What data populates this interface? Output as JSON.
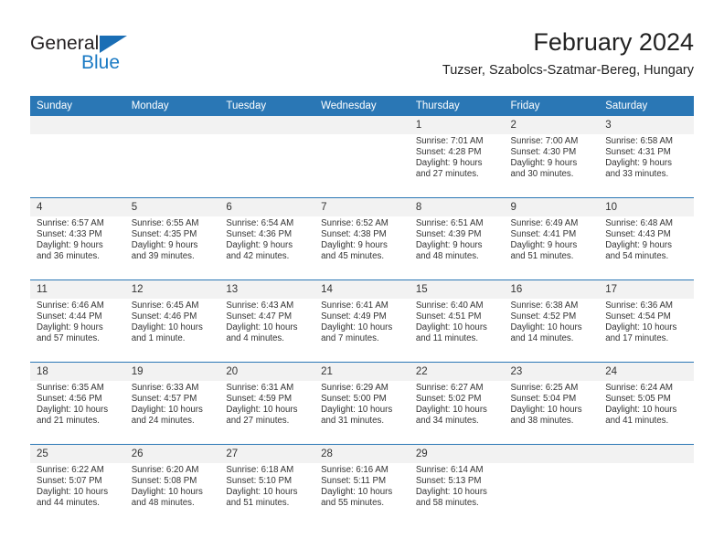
{
  "brand": {
    "name_part1": "General",
    "name_part2": "Blue",
    "triangle_icon": "triangle-icon",
    "accent_color": "#1a7ac4"
  },
  "header": {
    "title": "February 2024",
    "subtitle": "Tuzser, Szabolcs-Szatmar-Bereg, Hungary"
  },
  "calendar": {
    "header_bg": "#2a77b5",
    "daynum_bg": "#f2f2f2",
    "weekday_headers": [
      "Sunday",
      "Monday",
      "Tuesday",
      "Wednesday",
      "Thursday",
      "Friday",
      "Saturday"
    ],
    "weeks": [
      [
        {
          "day": "",
          "sunrise": "",
          "sunset": "",
          "daylight_line1": "",
          "daylight_line2": "",
          "empty": true
        },
        {
          "day": "",
          "sunrise": "",
          "sunset": "",
          "daylight_line1": "",
          "daylight_line2": "",
          "empty": true
        },
        {
          "day": "",
          "sunrise": "",
          "sunset": "",
          "daylight_line1": "",
          "daylight_line2": "",
          "empty": true
        },
        {
          "day": "",
          "sunrise": "",
          "sunset": "",
          "daylight_line1": "",
          "daylight_line2": "",
          "empty": true
        },
        {
          "day": "1",
          "sunrise": "Sunrise: 7:01 AM",
          "sunset": "Sunset: 4:28 PM",
          "daylight_line1": "Daylight: 9 hours",
          "daylight_line2": "and 27 minutes.",
          "empty": false
        },
        {
          "day": "2",
          "sunrise": "Sunrise: 7:00 AM",
          "sunset": "Sunset: 4:30 PM",
          "daylight_line1": "Daylight: 9 hours",
          "daylight_line2": "and 30 minutes.",
          "empty": false
        },
        {
          "day": "3",
          "sunrise": "Sunrise: 6:58 AM",
          "sunset": "Sunset: 4:31 PM",
          "daylight_line1": "Daylight: 9 hours",
          "daylight_line2": "and 33 minutes.",
          "empty": false
        }
      ],
      [
        {
          "day": "4",
          "sunrise": "Sunrise: 6:57 AM",
          "sunset": "Sunset: 4:33 PM",
          "daylight_line1": "Daylight: 9 hours",
          "daylight_line2": "and 36 minutes.",
          "empty": false
        },
        {
          "day": "5",
          "sunrise": "Sunrise: 6:55 AM",
          "sunset": "Sunset: 4:35 PM",
          "daylight_line1": "Daylight: 9 hours",
          "daylight_line2": "and 39 minutes.",
          "empty": false
        },
        {
          "day": "6",
          "sunrise": "Sunrise: 6:54 AM",
          "sunset": "Sunset: 4:36 PM",
          "daylight_line1": "Daylight: 9 hours",
          "daylight_line2": "and 42 minutes.",
          "empty": false
        },
        {
          "day": "7",
          "sunrise": "Sunrise: 6:52 AM",
          "sunset": "Sunset: 4:38 PM",
          "daylight_line1": "Daylight: 9 hours",
          "daylight_line2": "and 45 minutes.",
          "empty": false
        },
        {
          "day": "8",
          "sunrise": "Sunrise: 6:51 AM",
          "sunset": "Sunset: 4:39 PM",
          "daylight_line1": "Daylight: 9 hours",
          "daylight_line2": "and 48 minutes.",
          "empty": false
        },
        {
          "day": "9",
          "sunrise": "Sunrise: 6:49 AM",
          "sunset": "Sunset: 4:41 PM",
          "daylight_line1": "Daylight: 9 hours",
          "daylight_line2": "and 51 minutes.",
          "empty": false
        },
        {
          "day": "10",
          "sunrise": "Sunrise: 6:48 AM",
          "sunset": "Sunset: 4:43 PM",
          "daylight_line1": "Daylight: 9 hours",
          "daylight_line2": "and 54 minutes.",
          "empty": false
        }
      ],
      [
        {
          "day": "11",
          "sunrise": "Sunrise: 6:46 AM",
          "sunset": "Sunset: 4:44 PM",
          "daylight_line1": "Daylight: 9 hours",
          "daylight_line2": "and 57 minutes.",
          "empty": false
        },
        {
          "day": "12",
          "sunrise": "Sunrise: 6:45 AM",
          "sunset": "Sunset: 4:46 PM",
          "daylight_line1": "Daylight: 10 hours",
          "daylight_line2": "and 1 minute.",
          "empty": false
        },
        {
          "day": "13",
          "sunrise": "Sunrise: 6:43 AM",
          "sunset": "Sunset: 4:47 PM",
          "daylight_line1": "Daylight: 10 hours",
          "daylight_line2": "and 4 minutes.",
          "empty": false
        },
        {
          "day": "14",
          "sunrise": "Sunrise: 6:41 AM",
          "sunset": "Sunset: 4:49 PM",
          "daylight_line1": "Daylight: 10 hours",
          "daylight_line2": "and 7 minutes.",
          "empty": false
        },
        {
          "day": "15",
          "sunrise": "Sunrise: 6:40 AM",
          "sunset": "Sunset: 4:51 PM",
          "daylight_line1": "Daylight: 10 hours",
          "daylight_line2": "and 11 minutes.",
          "empty": false
        },
        {
          "day": "16",
          "sunrise": "Sunrise: 6:38 AM",
          "sunset": "Sunset: 4:52 PM",
          "daylight_line1": "Daylight: 10 hours",
          "daylight_line2": "and 14 minutes.",
          "empty": false
        },
        {
          "day": "17",
          "sunrise": "Sunrise: 6:36 AM",
          "sunset": "Sunset: 4:54 PM",
          "daylight_line1": "Daylight: 10 hours",
          "daylight_line2": "and 17 minutes.",
          "empty": false
        }
      ],
      [
        {
          "day": "18",
          "sunrise": "Sunrise: 6:35 AM",
          "sunset": "Sunset: 4:56 PM",
          "daylight_line1": "Daylight: 10 hours",
          "daylight_line2": "and 21 minutes.",
          "empty": false
        },
        {
          "day": "19",
          "sunrise": "Sunrise: 6:33 AM",
          "sunset": "Sunset: 4:57 PM",
          "daylight_line1": "Daylight: 10 hours",
          "daylight_line2": "and 24 minutes.",
          "empty": false
        },
        {
          "day": "20",
          "sunrise": "Sunrise: 6:31 AM",
          "sunset": "Sunset: 4:59 PM",
          "daylight_line1": "Daylight: 10 hours",
          "daylight_line2": "and 27 minutes.",
          "empty": false
        },
        {
          "day": "21",
          "sunrise": "Sunrise: 6:29 AM",
          "sunset": "Sunset: 5:00 PM",
          "daylight_line1": "Daylight: 10 hours",
          "daylight_line2": "and 31 minutes.",
          "empty": false
        },
        {
          "day": "22",
          "sunrise": "Sunrise: 6:27 AM",
          "sunset": "Sunset: 5:02 PM",
          "daylight_line1": "Daylight: 10 hours",
          "daylight_line2": "and 34 minutes.",
          "empty": false
        },
        {
          "day": "23",
          "sunrise": "Sunrise: 6:25 AM",
          "sunset": "Sunset: 5:04 PM",
          "daylight_line1": "Daylight: 10 hours",
          "daylight_line2": "and 38 minutes.",
          "empty": false
        },
        {
          "day": "24",
          "sunrise": "Sunrise: 6:24 AM",
          "sunset": "Sunset: 5:05 PM",
          "daylight_line1": "Daylight: 10 hours",
          "daylight_line2": "and 41 minutes.",
          "empty": false
        }
      ],
      [
        {
          "day": "25",
          "sunrise": "Sunrise: 6:22 AM",
          "sunset": "Sunset: 5:07 PM",
          "daylight_line1": "Daylight: 10 hours",
          "daylight_line2": "and 44 minutes.",
          "empty": false
        },
        {
          "day": "26",
          "sunrise": "Sunrise: 6:20 AM",
          "sunset": "Sunset: 5:08 PM",
          "daylight_line1": "Daylight: 10 hours",
          "daylight_line2": "and 48 minutes.",
          "empty": false
        },
        {
          "day": "27",
          "sunrise": "Sunrise: 6:18 AM",
          "sunset": "Sunset: 5:10 PM",
          "daylight_line1": "Daylight: 10 hours",
          "daylight_line2": "and 51 minutes.",
          "empty": false
        },
        {
          "day": "28",
          "sunrise": "Sunrise: 6:16 AM",
          "sunset": "Sunset: 5:11 PM",
          "daylight_line1": "Daylight: 10 hours",
          "daylight_line2": "and 55 minutes.",
          "empty": false
        },
        {
          "day": "29",
          "sunrise": "Sunrise: 6:14 AM",
          "sunset": "Sunset: 5:13 PM",
          "daylight_line1": "Daylight: 10 hours",
          "daylight_line2": "and 58 minutes.",
          "empty": false
        },
        {
          "day": "",
          "sunrise": "",
          "sunset": "",
          "daylight_line1": "",
          "daylight_line2": "",
          "empty": true
        },
        {
          "day": "",
          "sunrise": "",
          "sunset": "",
          "daylight_line1": "",
          "daylight_line2": "",
          "empty": true
        }
      ]
    ]
  }
}
